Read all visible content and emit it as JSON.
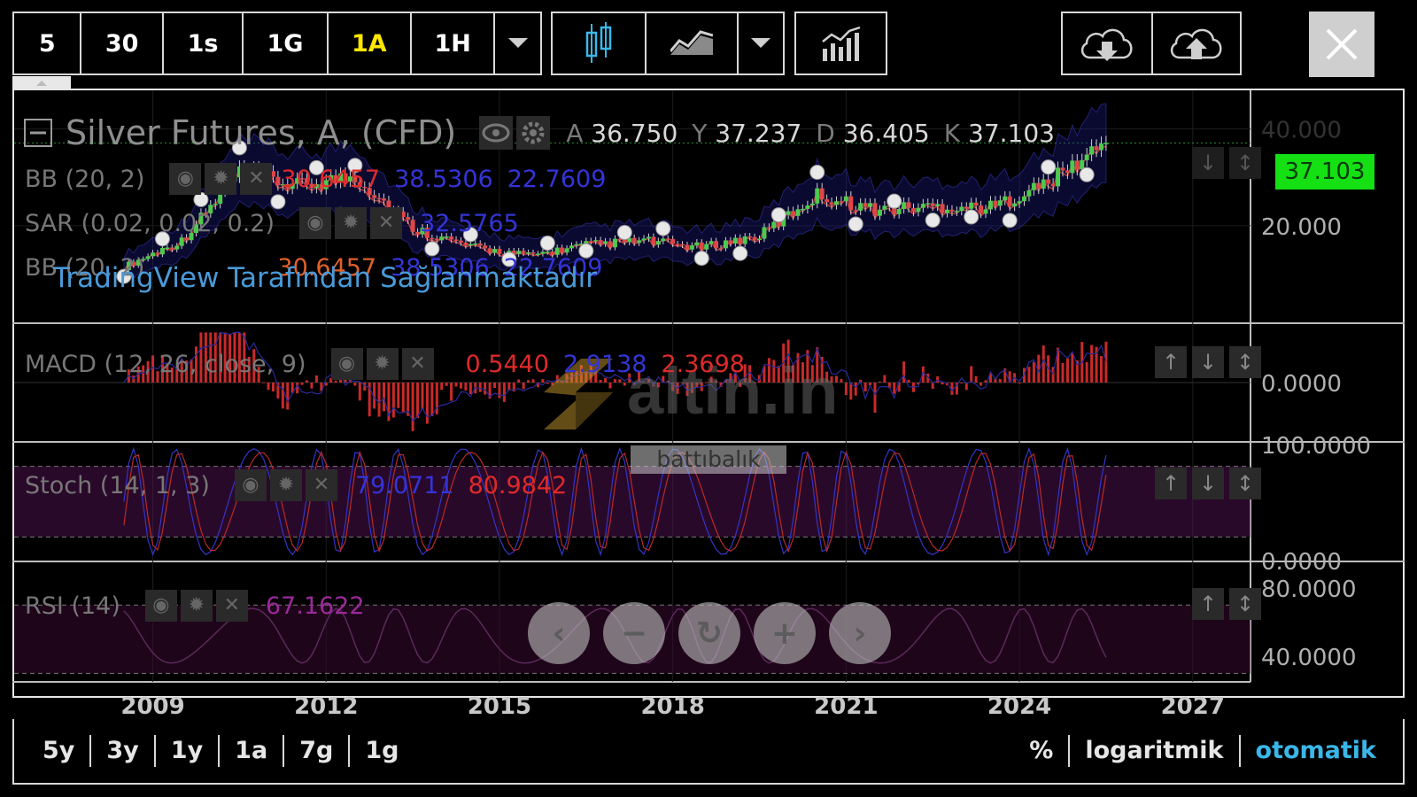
{
  "toolbar": {
    "intervals": [
      "5",
      "30",
      "1s",
      "1G",
      "1A",
      "1H"
    ],
    "active_interval": "1A"
  },
  "header": {
    "title": "Silver Futures, A, (CFD)",
    "ohlc": [
      {
        "k": "A",
        "v": "36.750"
      },
      {
        "k": "Y",
        "v": "37.237"
      },
      {
        "k": "D",
        "v": "36.405"
      },
      {
        "k": "K",
        "v": "37.103"
      }
    ],
    "last_price": "37.103"
  },
  "indicators": {
    "bb1": {
      "label": "BB (20, 2)",
      "v1": "30.6457",
      "v2": "38.5306",
      "v3": "22.7609"
    },
    "sar": {
      "label": "SAR (0.02, 0.02, 0.2)",
      "v1": "32.5765"
    },
    "bb2": {
      "label": "BB (20, 2)",
      "v1": "30.6457",
      "v2": "38.5306",
      "v3": "22.7609"
    },
    "credit": "TradingView Tarafından Sağlanmaktadır",
    "macd": {
      "label": "MACD (12, 26, close, 9)",
      "v1": "0.5440",
      "v2": "2.9138",
      "v3": "2.3698"
    },
    "stoch": {
      "label": "Stoch (14, 1, 3)",
      "v1": "79.0711",
      "v2": "80.9842"
    },
    "rsi": {
      "label": "RSI (14)",
      "v1": "67.1622"
    }
  },
  "axes": {
    "price_ticks": [
      "40.000",
      "20.000"
    ],
    "macd_ticks": [
      "0.0000"
    ],
    "stoch_ticks": [
      "100.0000",
      "0.0000"
    ],
    "rsi_ticks": [
      "80.0000",
      "40.0000"
    ],
    "x_ticks": [
      "2009",
      "2012",
      "2015",
      "2018",
      "2021",
      "2024",
      "2027"
    ]
  },
  "watermark": {
    "logo": "altin.in",
    "sub": "battıbalık"
  },
  "range_bar": {
    "left": [
      "5y",
      "3y",
      "1y",
      "1a",
      "7g",
      "1g"
    ],
    "right": [
      "%",
      "logaritmik",
      "otomatik"
    ],
    "active": "otomatik"
  },
  "colors": {
    "up": "#4ec94e",
    "down": "#e04646",
    "bb_band": "#2a2aaf",
    "last_price_bg": "#14e014",
    "active_text": "#ffe600",
    "accent": "#3ab7e8"
  },
  "chart_data": {
    "type": "candlestick",
    "title": "Silver Futures, A, (CFD)",
    "x": [
      "2008",
      "2009",
      "2010",
      "2011",
      "2012",
      "2013",
      "2014",
      "2015",
      "2016",
      "2017",
      "2018",
      "2019",
      "2020",
      "2021",
      "2022",
      "2023",
      "2024",
      "2025"
    ],
    "close": [
      11.5,
      16.9,
      30.9,
      28.2,
      30.3,
      19.5,
      15.6,
      13.8,
      16.0,
      16.9,
      15.5,
      17.9,
      26.4,
      23.3,
      24.0,
      23.8,
      28.9,
      37.1
    ],
    "xlim": [
      2006.6,
      2028.0
    ],
    "price_ylim": [
      0,
      48
    ],
    "macd_ylim": [
      -7,
      7
    ],
    "stoch_ylim": [
      0,
      100
    ],
    "rsi_ylim": [
      25,
      95
    ]
  }
}
